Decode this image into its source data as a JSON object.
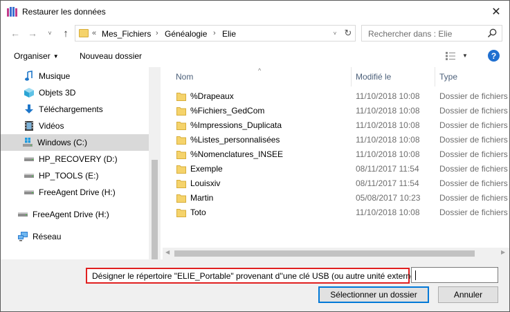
{
  "window": {
    "title": "Restaurer les données",
    "close_glyph": "✕"
  },
  "nav": {
    "back_glyph": "←",
    "forward_glyph": "→",
    "history_glyph": "˅",
    "up_glyph": "↑",
    "breadcrumb": {
      "overflow": "«",
      "sep": "›",
      "items": [
        "Mes_Fichiers",
        "Généalogie",
        "Elie"
      ]
    },
    "dropdown_glyph": "˅",
    "refresh_glyph": "↻",
    "search_placeholder": "Rechercher dans : Elie"
  },
  "toolbar": {
    "organize_label": "Organiser",
    "organize_caret": "▼",
    "new_folder_label": "Nouveau dossier",
    "view_caret": "▼",
    "help_label": "?"
  },
  "sidebar": {
    "items": [
      {
        "label": "Musique",
        "icon": "music-icon"
      },
      {
        "label": "Objets 3D",
        "icon": "3d-objects-icon"
      },
      {
        "label": "Téléchargements",
        "icon": "download-icon"
      },
      {
        "label": "Vidéos",
        "icon": "video-icon"
      },
      {
        "label": "Windows  (C:)",
        "icon": "windows-drive-icon",
        "selected": true
      },
      {
        "label": "HP_RECOVERY (D:)",
        "icon": "drive-icon"
      },
      {
        "label": "HP_TOOLS (E:)",
        "icon": "drive-icon"
      },
      {
        "label": "FreeAgent Drive (H:)",
        "icon": "drive-icon"
      },
      {
        "label": "FreeAgent Drive (H:)",
        "icon": "drive-icon"
      },
      {
        "label": "Réseau",
        "icon": "network-icon"
      }
    ]
  },
  "filelist": {
    "columns": {
      "name": "Nom",
      "modified": "Modifié le",
      "type": "Type"
    },
    "sort_glyph": "^",
    "rows": [
      {
        "name": "%Drapeaux",
        "modified": "11/10/2018 10:08",
        "type": "Dossier de fichiers"
      },
      {
        "name": "%Fichiers_GedCom",
        "modified": "11/10/2018 10:08",
        "type": "Dossier de fichiers"
      },
      {
        "name": "%Impressions_Duplicata",
        "modified": "11/10/2018 10:08",
        "type": "Dossier de fichiers"
      },
      {
        "name": "%Listes_personnalisées",
        "modified": "11/10/2018 10:08",
        "type": "Dossier de fichiers"
      },
      {
        "name": "%Nomenclatures_INSEE",
        "modified": "11/10/2018 10:08",
        "type": "Dossier de fichiers"
      },
      {
        "name": "Exemple",
        "modified": "08/11/2017 11:54",
        "type": "Dossier de fichiers"
      },
      {
        "name": "Louisxiv",
        "modified": "08/11/2017 11:54",
        "type": "Dossier de fichiers"
      },
      {
        "name": "Martin",
        "modified": "05/08/2017 10:23",
        "type": "Dossier de fichiers"
      },
      {
        "name": "Toto",
        "modified": "11/10/2018 10:08",
        "type": "Dossier de fichiers"
      }
    ],
    "scroll_left_glyph": "◀",
    "scroll_right_glyph": "▶"
  },
  "footer": {
    "folder_label": "Désigner le répertoire \"ELIE_Portable\" provenant d''une clé USB (ou autre unité externe)",
    "folder_value": "",
    "select_button": "Sélectionner un dossier",
    "cancel_button": "Annuler"
  },
  "colors": {
    "accent": "#0078d7",
    "highlight_border": "#e02020",
    "folder": "#f5d36b",
    "help": "#1f6fd0"
  }
}
